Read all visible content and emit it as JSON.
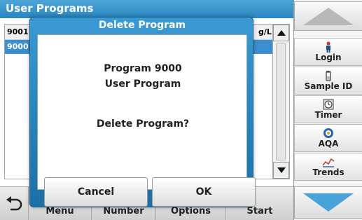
{
  "title_bar": {
    "title": "User Programs"
  },
  "list": {
    "header_number": "9001",
    "header_unit": "g/L",
    "rows": [
      {
        "number": "9000",
        "selected": true
      }
    ]
  },
  "bottom_bar": {
    "buttons": [
      "Menu",
      "Number",
      "Options",
      "Start"
    ]
  },
  "sidebar": {
    "items": [
      {
        "label": "Login",
        "icon": "person-icon"
      },
      {
        "label": "Sample ID",
        "icon": "vial-icon"
      },
      {
        "label": "Timer",
        "icon": "timer-icon"
      },
      {
        "label": "AQA",
        "icon": "aqa-icon"
      },
      {
        "label": "Trends",
        "icon": "trends-icon"
      }
    ]
  },
  "dialog": {
    "title": "Delete Program",
    "line1": "Program 9000",
    "line2": "User Program",
    "question": "Delete Program?",
    "cancel_label": "Cancel",
    "ok_label": "OK"
  },
  "colors": {
    "accent": "#2a86c0",
    "selected_row": "#3b8fd0",
    "nav_arrow": "#4aa3d8"
  }
}
